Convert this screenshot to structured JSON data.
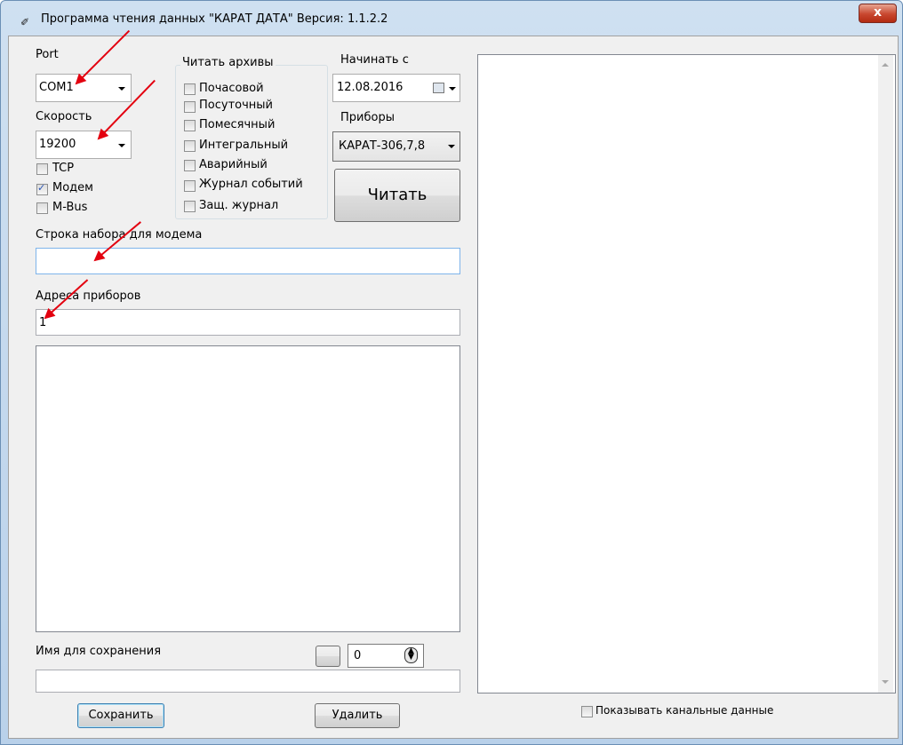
{
  "window": {
    "title": "Программа чтения данных \"КАРАТ ДАТА\"   Версия: 1.1.2.2",
    "close": "x"
  },
  "port": {
    "label": "Port",
    "value": "COM1"
  },
  "speed": {
    "label": "Скорость",
    "value": "19200"
  },
  "conn": {
    "tcp": "TCP",
    "modem": "Модем",
    "mbus": "M-Bus",
    "modem_checked": true
  },
  "archives": {
    "title": "Читать архивы",
    "items": [
      "Почасовой",
      "Посуточный",
      "Помесячный",
      "Интегральный",
      "Аварийный",
      "Журнал событий",
      "Защ. журнал"
    ]
  },
  "start": {
    "label": "Начинать с",
    "date": "12.08.2016"
  },
  "devices": {
    "label": "Приборы",
    "value": "КАРАТ-306,7,8"
  },
  "read_button": "Читать",
  "dial": {
    "label": "Строка набора для модема",
    "value": ""
  },
  "addresses": {
    "label": "Адреса приборов",
    "value": "1"
  },
  "save_name": {
    "label": "Имя для сохранения",
    "value": "",
    "counter": "0"
  },
  "buttons": {
    "save": "Сохранить",
    "delete": "Удалить"
  },
  "channel_data": {
    "label": "Показывать канальные данные"
  },
  "colors": {
    "arrow": "#e3000f",
    "title_gradient": "#cfe0f1"
  }
}
